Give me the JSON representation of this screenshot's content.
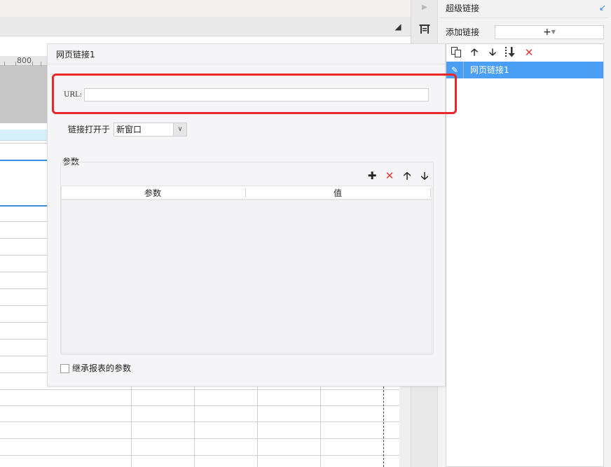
{
  "right_panel": {
    "title": "超级链接",
    "add_label": "添加链接",
    "add_button": "+",
    "toolbar_icons": [
      "copy-icon",
      "arrow-up-icon",
      "arrow-down-icon",
      "sort-icon",
      "delete-icon"
    ],
    "items": [
      {
        "label": "网页链接1",
        "icon": "pencil-icon",
        "selected": true
      }
    ]
  },
  "dialog": {
    "title": "网页链接1",
    "url_label": "URL:",
    "url_value": "",
    "open_in_label": "链接打开于",
    "open_in_value": "新窗口",
    "params_label": "参数",
    "params_tool_icons": [
      "add-icon",
      "delete-icon",
      "arrow-up-icon",
      "arrow-down-icon"
    ],
    "params_columns": [
      "参数",
      "值"
    ],
    "params_rows": [],
    "inherit_checkbox_label": "继承报表的参数",
    "inherit_checked": false
  },
  "background": {
    "ruler_label": "800"
  },
  "colors": {
    "accent_blue": "#4a9ff5",
    "highlight_red": "#e8262b",
    "delete_red": "#e53935"
  }
}
